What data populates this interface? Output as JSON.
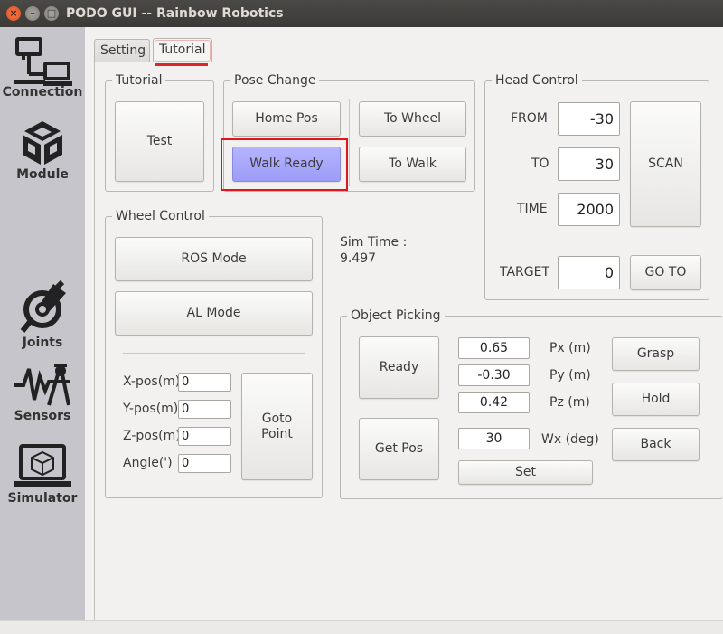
{
  "window": {
    "title": "PODO GUI -- Rainbow Robotics",
    "close": "×",
    "minimize": "–",
    "maximize": "□"
  },
  "sidebar": {
    "items": [
      {
        "label": "Connection",
        "icon": "connection-icon"
      },
      {
        "label": "Module",
        "icon": "module-icon"
      },
      {
        "label": "Joints",
        "icon": "joints-icon"
      },
      {
        "label": "Sensors",
        "icon": "sensors-icon"
      },
      {
        "label": "Simulator",
        "icon": "simulator-icon"
      }
    ]
  },
  "tabs": [
    {
      "label": "Setting",
      "active": false
    },
    {
      "label": "Tutorial",
      "active": true
    }
  ],
  "tutorial": {
    "title": "Tutorial",
    "test": "Test"
  },
  "pose_change": {
    "title": "Pose Change",
    "home_pos": "Home Pos",
    "walk_ready": "Walk Ready",
    "to_wheel": "To Wheel",
    "to_walk": "To Walk"
  },
  "head_control": {
    "title": "Head Control",
    "from_label": "FROM",
    "from_value": "-30",
    "to_label": "TO",
    "to_value": "30",
    "time_label": "TIME",
    "time_value": "2000",
    "target_label": "TARGET",
    "target_value": "0",
    "scan": "SCAN",
    "goto": "GO TO"
  },
  "wheel_control": {
    "title": "Wheel Control",
    "ros_mode": "ROS Mode",
    "al_mode": "AL Mode",
    "x_label": "X-pos(m)",
    "x_value": "0",
    "y_label": "Y-pos(m)",
    "y_value": "0",
    "z_label": "Z-pos(m)",
    "z_value": "0",
    "angle_label": "Angle(')",
    "angle_value": "0",
    "goto_point": "Goto Point"
  },
  "sim_time": {
    "label": "Sim Time :",
    "value": "9.497"
  },
  "object_picking": {
    "title": "Object Picking",
    "ready": "Ready",
    "get_pos": "Get Pos",
    "px_value": "0.65",
    "px_label": "Px (m)",
    "py_value": "-0.30",
    "py_label": "Py (m)",
    "pz_value": "0.42",
    "pz_label": "Pz (m)",
    "wx_value": "30",
    "wx_label": "Wx (deg)",
    "set": "Set",
    "grasp": "Grasp",
    "hold": "Hold",
    "back": "Back"
  },
  "colors": {
    "highlight": "#a8a7fc",
    "annotation_red": "#e0161e",
    "sidebar_bg": "#c6c5cc"
  }
}
